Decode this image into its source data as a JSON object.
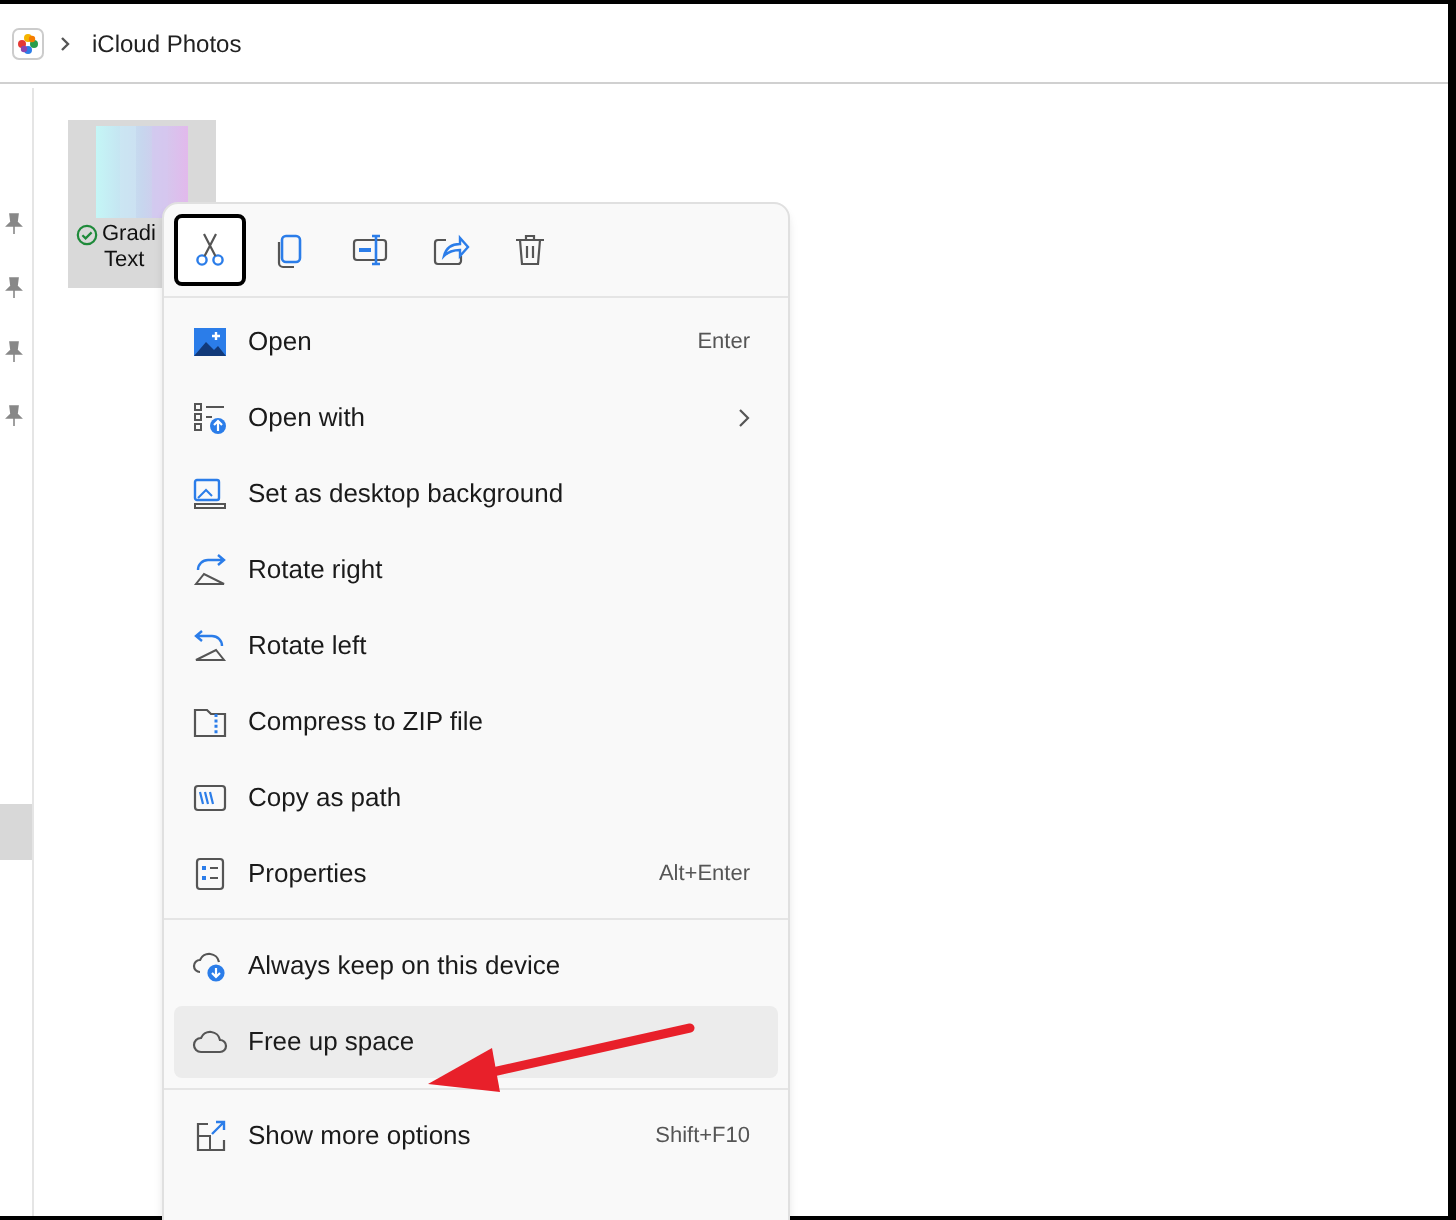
{
  "address_bar": {
    "breadcrumb": "iCloud Photos"
  },
  "file": {
    "name_line_1": "Gradi",
    "name_line_2": "Text",
    "selected": true,
    "synced": true
  },
  "context_menu": {
    "quick_actions": [
      {
        "selected": true
      },
      {
        "selected": false
      },
      {
        "selected": false
      },
      {
        "selected": false
      },
      {
        "selected": false
      }
    ],
    "groups": [
      [
        {
          "label": "Open",
          "shortcut": "Enter",
          "submenu": false,
          "selected": false
        },
        {
          "label": "Open with",
          "submenu": true,
          "selected": false
        },
        {
          "label": "Set as desktop background",
          "submenu": false,
          "selected": false
        },
        {
          "label": "Rotate right",
          "submenu": false,
          "selected": false
        },
        {
          "label": "Rotate left",
          "submenu": false,
          "selected": false
        },
        {
          "label": "Compress to ZIP file",
          "submenu": false,
          "selected": false
        },
        {
          "label": "Copy as path",
          "submenu": false,
          "selected": false
        },
        {
          "label": "Properties",
          "shortcut": "Alt+Enter",
          "submenu": false,
          "selected": false
        }
      ],
      [
        {
          "label": "Always keep on this device",
          "submenu": false,
          "selected": false
        },
        {
          "label": "Free up space",
          "submenu": false,
          "selected": true
        }
      ],
      [
        {
          "label": "Show more options",
          "shortcut": "Shift+F10",
          "submenu": false,
          "selected": false
        }
      ]
    ]
  }
}
